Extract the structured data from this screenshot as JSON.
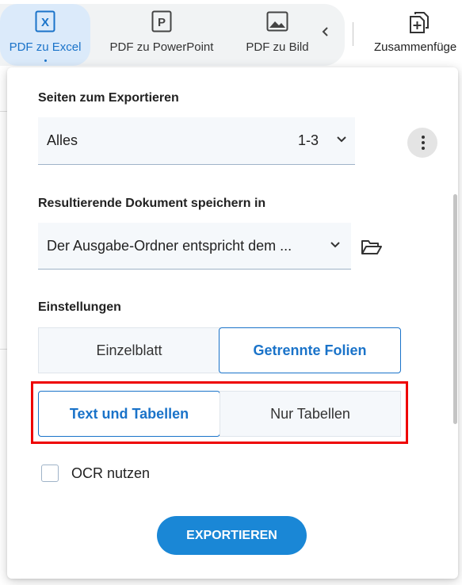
{
  "toolbar": {
    "tools": [
      {
        "label": "PDF zu Excel",
        "icon": "excel-icon",
        "active": true
      },
      {
        "label": "PDF zu PowerPoint",
        "icon": "powerpoint-icon"
      },
      {
        "label": "PDF zu Bild",
        "icon": "image-icon"
      }
    ],
    "scroll_left_icon": "chevron-left-icon",
    "merge_label": "Zusammenfüge",
    "merge_icon": "merge-files-icon"
  },
  "panel": {
    "pages_label": "Seiten zum Exportieren",
    "pages_select": {
      "value": "Alles",
      "range": "1-3"
    },
    "more_icon": "more-vertical-icon",
    "save_label": "Resultierende Dokument speichern in",
    "save_select": {
      "value": "Der Ausgabe-Ordner entspricht dem ..."
    },
    "folder_icon": "folder-open-icon",
    "settings_label": "Einstellungen",
    "sheet_options": [
      {
        "label": "Einzelblatt",
        "selected": false
      },
      {
        "label": "Getrennte Folien",
        "selected": true
      }
    ],
    "content_options": [
      {
        "label": "Text und Tabellen",
        "selected": true
      },
      {
        "label": "Nur Tabellen",
        "selected": false
      }
    ],
    "ocr": {
      "label": "OCR nutzen",
      "checked": false
    },
    "export_label": "EXPORTIEREN"
  },
  "colors": {
    "accent": "#1a73c9",
    "button": "#1a87d6",
    "highlight": "#ee0000"
  }
}
